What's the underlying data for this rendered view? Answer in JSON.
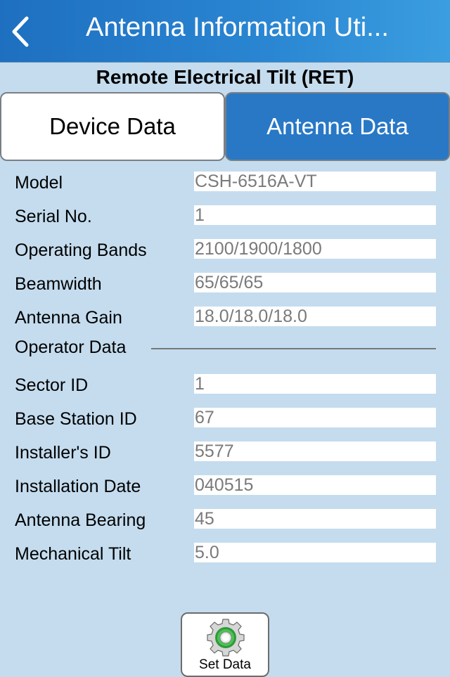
{
  "header": {
    "title": "Antenna Information Uti...",
    "back_icon": "chevron-left-icon"
  },
  "subtitle": "Remote Electrical Tilt (RET)",
  "tabs": [
    {
      "label": "Device Data",
      "selected": false
    },
    {
      "label": "Antenna Data",
      "selected": true
    }
  ],
  "antenna_fields": [
    {
      "label": "Model",
      "value": "CSH-6516A-VT"
    },
    {
      "label": "Serial No.",
      "value": "1"
    },
    {
      "label": "Operating Bands",
      "value": "2100/1900/1800"
    },
    {
      "label": "Beamwidth",
      "value": "65/65/65"
    },
    {
      "label": "Antenna Gain",
      "value": "18.0/18.0/18.0"
    }
  ],
  "operator_section": {
    "title": "Operator Data",
    "fields": [
      {
        "label": "Sector ID",
        "value": "1"
      },
      {
        "label": "Base Station ID",
        "value": "67"
      },
      {
        "label": "Installer's ID",
        "value": "5577"
      },
      {
        "label": "Installation Date",
        "value": "040515"
      },
      {
        "label": "Antenna Bearing",
        "value": "45"
      },
      {
        "label": "Mechanical Tilt",
        "value": "5.0"
      }
    ]
  },
  "set_button": {
    "label": "Set Data",
    "icon": "gear-icon"
  },
  "colors": {
    "accent": "#2878c6",
    "background": "#c4dcee",
    "selected_tab_text": "#ffffff"
  }
}
